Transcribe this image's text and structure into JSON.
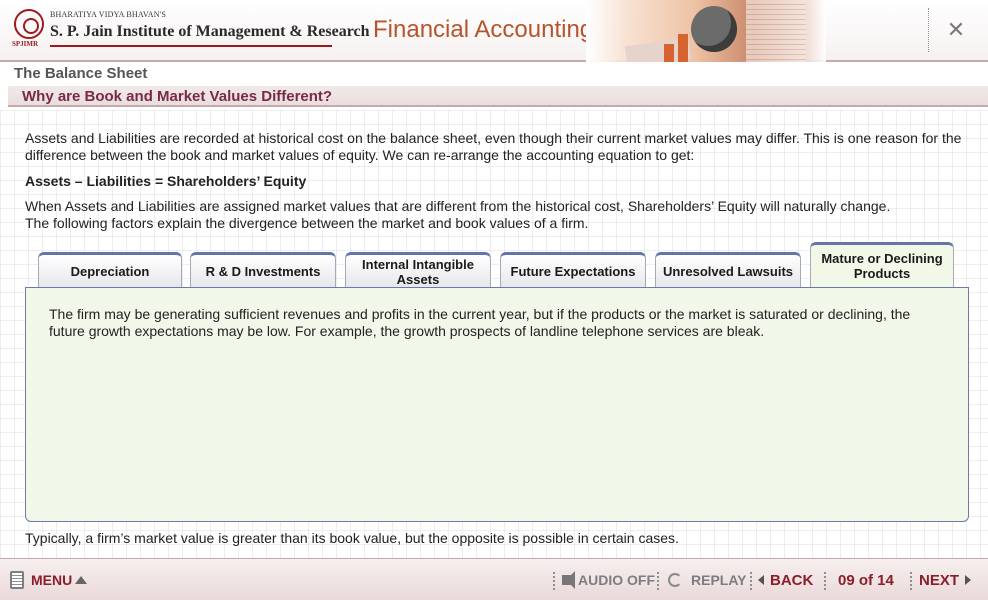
{
  "header": {
    "logo_small": "BHARATIYA VIDYA BHAVAN'S",
    "logo_name": "S. P. Jain Institute of Management & Research",
    "logo_abbr": "SPJIMR",
    "course_title": "Financial Accounting",
    "close_label": "✕"
  },
  "section": {
    "title": "The Balance Sheet",
    "subtitle": "Why are Book and Market Values Different?"
  },
  "content": {
    "intro": "Assets and Liabilities are recorded at historical cost on the balance sheet, even though their current market values may differ. This is one reason for the difference between the book and market values of equity. We can re-arrange the accounting equation to get:",
    "equation": "Assets – Liabilities = Shareholders’ Equity",
    "factors_intro_1": "When Assets and Liabilities are assigned market values that are different from the historical cost, Shareholders’ Equity will naturally change.",
    "factors_intro_2": "The following factors explain the divergence between the market and book values of a firm.",
    "conclusion": "Typically, a firm’s market value is greater than its book value, but the opposite is possible in certain cases."
  },
  "tabs": [
    {
      "label": "Depreciation"
    },
    {
      "label": "R & D Investments"
    },
    {
      "label": "Internal Intangible Assets"
    },
    {
      "label": "Future Expectations"
    },
    {
      "label": "Unresolved Lawsuits"
    },
    {
      "label": "Mature or Declining Products"
    }
  ],
  "active_tab": "Mature or Declining Products",
  "panel": {
    "text": "The firm may be generating sufficient revenues and profits in the current year, but if the products or the market is saturated or declining, the future growth expectations may be low. For example, the growth prospects of landline telephone services are bleak."
  },
  "footer": {
    "menu_label": "MENU",
    "audio_label": "AUDIO OFF",
    "replay_label": "REPLAY",
    "back_label": "BACK",
    "page_indicator": "09 of 14",
    "next_label": "NEXT"
  },
  "colors": {
    "brand_red": "#9b1b1f",
    "title_orange": "#b4552b",
    "subtitle_maroon": "#7a2a45",
    "footer_menu": "#8a1e2a",
    "footer_text": "#7d7d7d",
    "panel_bg": "#f2f8e9",
    "tab_accent": "#6675a8"
  }
}
